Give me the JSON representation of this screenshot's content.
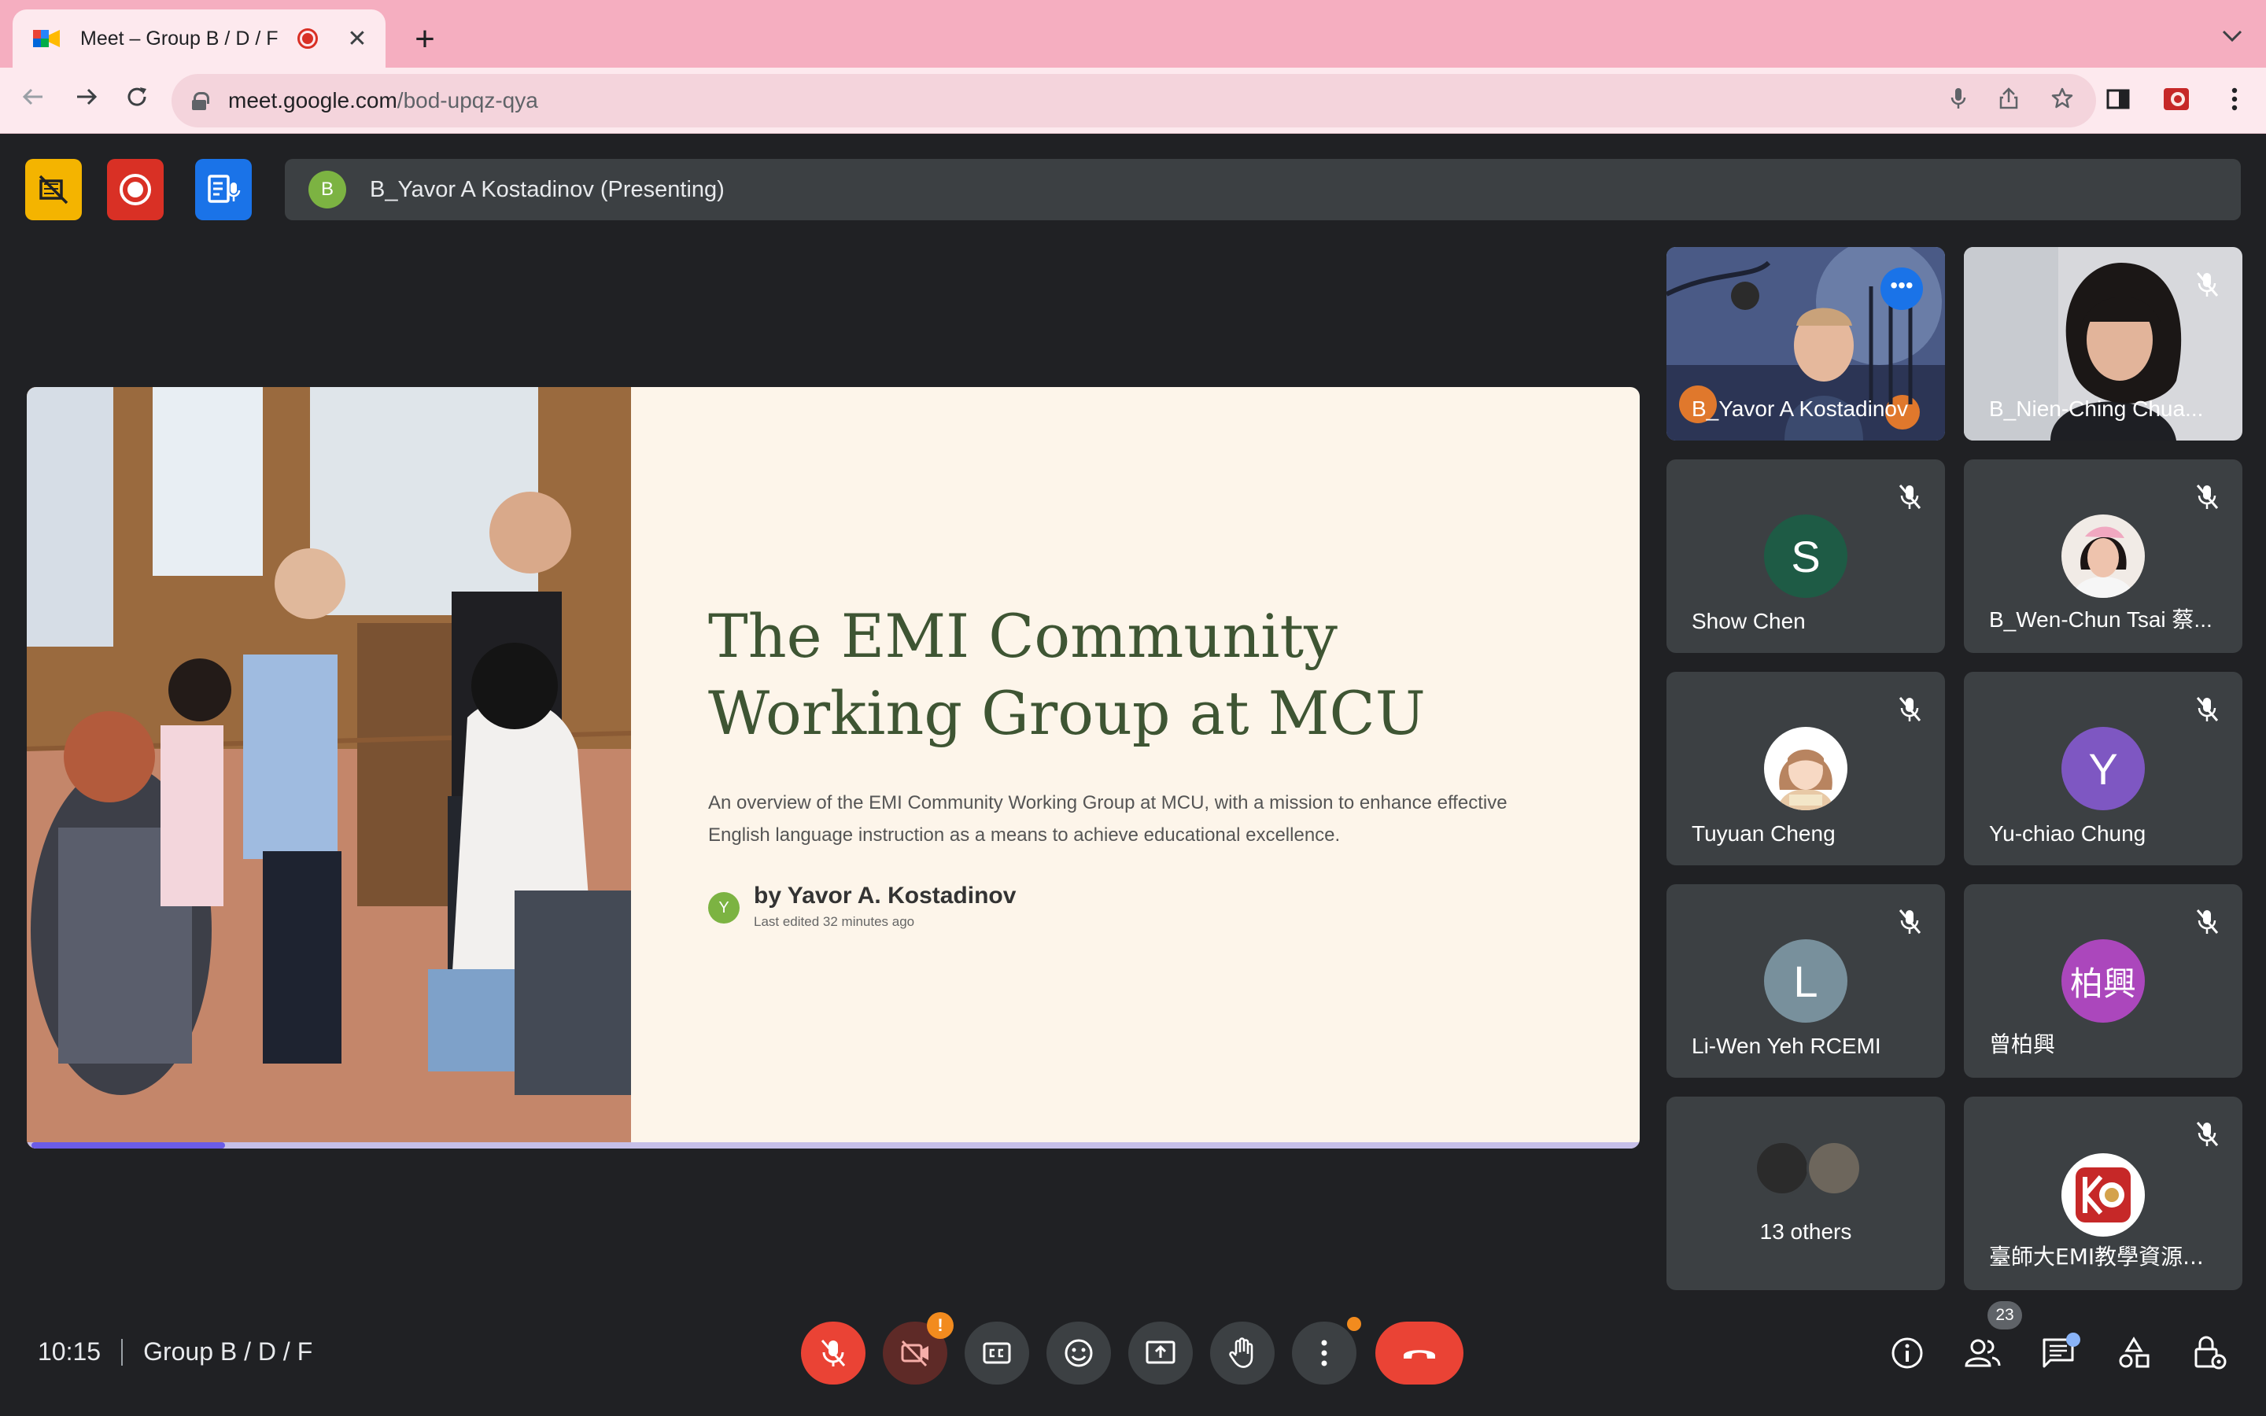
{
  "browser": {
    "tab_title": "Meet – Group B / D / F",
    "url_host": "meet.google.com",
    "url_path": "/bod-upqz-qya",
    "new_tab_symbol": "+",
    "close_symbol": "✕",
    "tab_list_symbol": "⌄"
  },
  "top_bar": {
    "presenter_initial": "B",
    "presenting_text": "B_Yavor A Kostadinov (Presenting)",
    "badges": [
      {
        "icon": "no-video-icon",
        "color": "#f4b400"
      },
      {
        "icon": "record-icon",
        "color": "#d93025"
      },
      {
        "icon": "transcript-icon",
        "color": "#1a73e8"
      }
    ]
  },
  "slide": {
    "title_line1": "The EMI Community",
    "title_line2": "Working Group at MCU",
    "description": "An overview of the EMI Community Working Group at MCU, with a mission to enhance effective English language instruction as a means to achieve educational excellence.",
    "author_initial": "Y",
    "author": "by Yavor A. Kostadinov",
    "last_edited": "Last edited 32 minutes ago",
    "progress_fraction": 0.12
  },
  "participants": [
    {
      "name": "B_Yavor A Kostadinov",
      "type": "video",
      "muted": false,
      "active": true
    },
    {
      "name": "B_Nien-Ching Chua...",
      "type": "video",
      "muted": true
    },
    {
      "name": "Show Chen",
      "initial": "S",
      "color": "#1e5b45",
      "muted": true
    },
    {
      "name": "B_Wen-Chun Tsai 蔡...",
      "type": "photo",
      "muted": true
    },
    {
      "name": "Tuyuan Cheng",
      "type": "cartoon",
      "muted": true
    },
    {
      "name": "Yu-chiao Chung",
      "initial": "Y",
      "color": "#7e57c2",
      "muted": true
    },
    {
      "name": "Li-Wen Yeh RCEMI",
      "initial": "L",
      "color": "#78909c",
      "muted": true
    },
    {
      "name": "曾柏興",
      "initial": "柏興",
      "color": "#ab47bc",
      "muted": true
    },
    {
      "name": "13 others",
      "type": "others"
    },
    {
      "name": "臺師大EMI教學資源...",
      "type": "logo",
      "muted": true
    }
  ],
  "bottom_bar": {
    "time": "10:15",
    "meeting_name": "Group B / D / F",
    "camera_alert": "!",
    "people_count": "23",
    "controls": [
      "mic-off-icon",
      "camera-off-icon",
      "captions-icon",
      "emoji-icon",
      "present-icon",
      "raise-hand-icon",
      "more-options-icon",
      "end-call-icon"
    ],
    "right_icons": [
      "info-icon",
      "people-icon",
      "chat-icon",
      "activities-icon",
      "host-controls-icon"
    ]
  }
}
